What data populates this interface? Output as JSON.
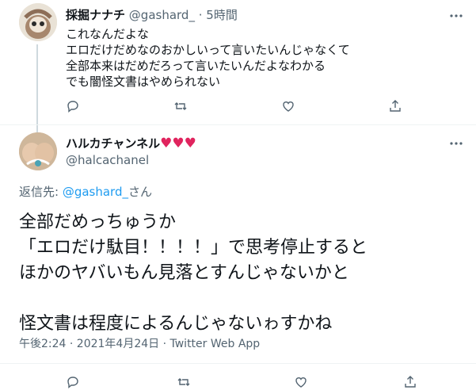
{
  "reply_tweet": {
    "display_name": "採掘ナナチ",
    "handle": "@gashard_",
    "separator": "·",
    "time": "5時間",
    "lines": [
      "これなんだよな",
      "エロだけだめなのおかしいって言いたいんじゃなくて",
      "全部本来はだめだろって言いたいんだよなわかる",
      "でも闇怪文書はやめられない"
    ]
  },
  "main_tweet": {
    "display_name": "ハルカチャンネル",
    "name_emoji": "♥♥♥",
    "handle": "@halcachanel",
    "replying_to_prefix": "返信先: ",
    "replying_to_handle": "@gashard_",
    "replying_to_suffix": "さん",
    "lines": [
      "全部だめっちゅうか",
      "「エロだけ駄目！！！！」で思考停止すると",
      "ほかのヤバいもん見落とすんじゃないかと",
      "",
      "怪文書は程度によるんじゃないゎすかね"
    ],
    "timestamp": "午後2:24 · 2021年4月24日 · Twitter Web App"
  },
  "colors": {
    "accent": "#1d9bf0",
    "text": "#0f1419",
    "muted": "#536471",
    "heart": "#e0245e"
  },
  "icons": [
    "more-icon",
    "reply-icon",
    "retweet-icon",
    "like-icon",
    "share-icon"
  ]
}
